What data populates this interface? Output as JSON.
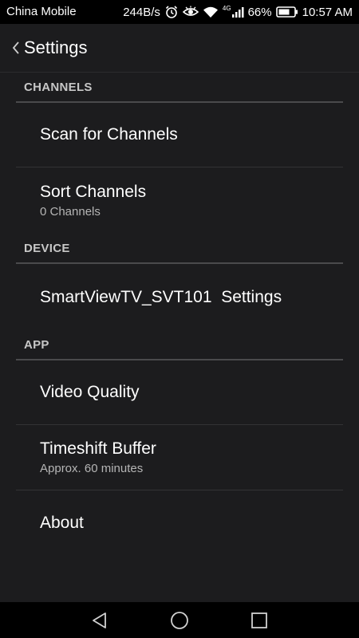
{
  "status_bar": {
    "carrier": "China Mobile",
    "net_speed": "244B/s",
    "network_type": "4G",
    "battery_percent": "66%",
    "time": "10:57 AM",
    "icons": [
      "alarm-icon",
      "eye-icon",
      "wifi-icon",
      "signal-icon",
      "battery-icon"
    ]
  },
  "header": {
    "title": "Settings",
    "back_icon": "chevron-left-icon"
  },
  "sections": {
    "channels": {
      "title": "CHANNELS",
      "items": [
        {
          "label": "Scan for Channels"
        },
        {
          "label": "Sort Channels",
          "sub": "0 Channels"
        }
      ]
    },
    "device": {
      "title": "DEVICE",
      "items": [
        {
          "label": "SmartViewTV_SVT101  Settings"
        }
      ]
    },
    "app": {
      "title": "APP",
      "items": [
        {
          "label": "Video Quality"
        },
        {
          "label": "Timeshift Buffer",
          "sub": "Approx. 60 minutes"
        },
        {
          "label": "About"
        }
      ]
    }
  },
  "nav_bar": {
    "icons": [
      "back-triangle-icon",
      "home-circle-icon",
      "recents-square-icon"
    ]
  },
  "colors": {
    "background": "#1c1c1e",
    "status_bar": "#000000",
    "section_header_text": "#c7c7c7",
    "subtext": "#b5b5b5"
  }
}
